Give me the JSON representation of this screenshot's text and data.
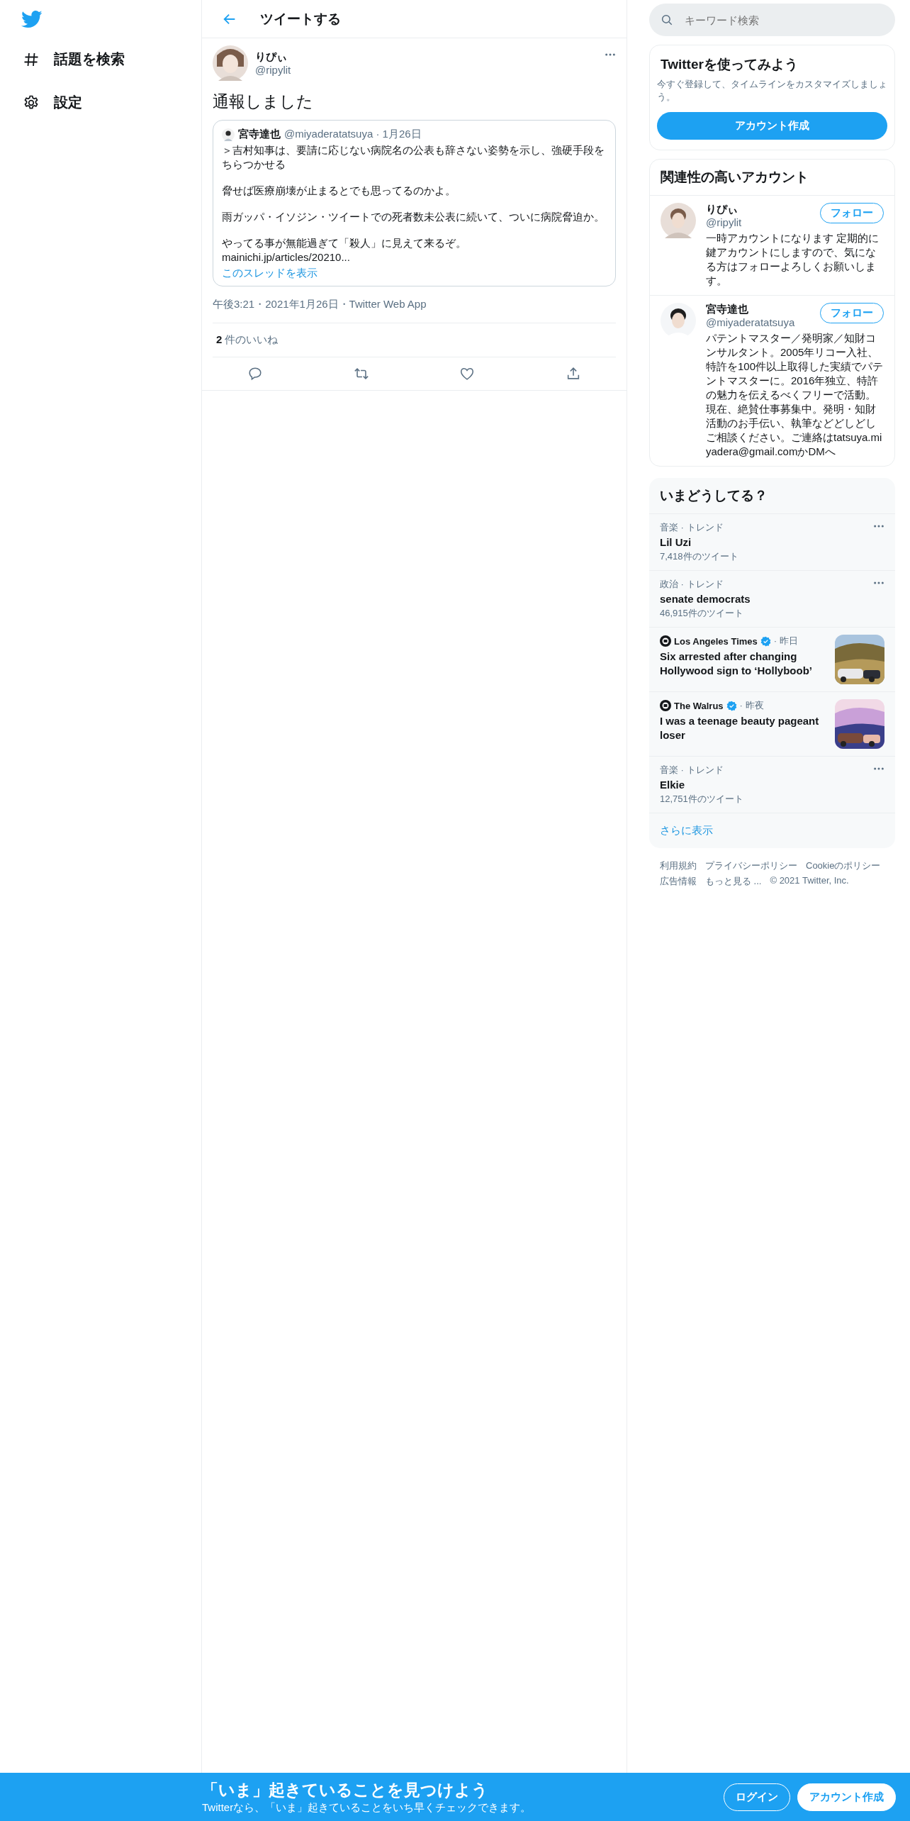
{
  "sidebar": {
    "items": [
      {
        "kind": "explore",
        "label": "話題を検索"
      },
      {
        "kind": "settings",
        "label": "設定"
      }
    ]
  },
  "header": {
    "title": "ツイートする"
  },
  "tweet": {
    "name": "りぴぃ",
    "handle": "@ripylit",
    "text": "通報しました",
    "quote": {
      "name": "宮寺達也",
      "meta": "@miyaderatatsuya · 1月26日",
      "paragraphs": [
        "＞吉村知事は、要請に応じない病院名の公表も辞さない姿勢を示し、強硬手段をちらつかせる",
        "脅せば医療崩壊が止まるとでも思ってるのかよ。",
        "雨ガッパ・イソジン・ツイートでの死者数未公表に続いて、ついに病院脅迫か。",
        "やってる事が無能過ぎて「殺人」に見えて来るぞ。\nmainichi.jp/articles/20210..."
      ],
      "thread_link": "このスレッドを表示"
    },
    "timestamp": "午後3:21・2021年1月26日・Twitter Web App",
    "likes": {
      "count": "2",
      "label": "件のいいね"
    },
    "actions": [
      {
        "kind": "reply"
      },
      {
        "kind": "retweet"
      },
      {
        "kind": "like"
      },
      {
        "kind": "share"
      }
    ]
  },
  "search": {
    "placeholder": "キーワード検索"
  },
  "signup": {
    "title": "Twitterを使ってみよう",
    "text": "今すぐ登録して、タイムラインをカスタマイズしましょう。",
    "button": "アカウント作成"
  },
  "related": {
    "title": "関連性の高いアカウント",
    "accounts": [
      {
        "name": "りぴぃ",
        "handle": "@ripylit",
        "follow": "フォロー",
        "bio": "一時アカウントになります 定期的に鍵アカウントにしますので、気になる方はフォローよろしくお願いします。"
      },
      {
        "name": "宮寺達也",
        "handle": "@miyaderatatsuya",
        "follow": "フォロー",
        "bio": "パテントマスター／発明家／知財コンサルタント。2005年リコー入社、特許を100件以上取得した実績でパテントマスターに。2016年独立、特許の魅力を伝えるべくフリーで活動。現在、絶賛仕事募集中。発明・知財活動のお手伝い、執筆などどしどしご相談ください。ご連絡はtatsuya.miyadera@gmail.comかDMへ"
      }
    ]
  },
  "trends": {
    "title": "いまどうしてる？",
    "items": [
      {
        "kind": "trend",
        "category": "音楽 · トレンド",
        "name": "Lil Uzi",
        "count": "7,418件のツイート"
      },
      {
        "kind": "trend",
        "category": "政治 · トレンド",
        "name": "senate democrats",
        "count": "46,915件のツイート"
      },
      {
        "kind": "news",
        "source": "Los Angeles Times",
        "verified": true,
        "time": "· 昨日",
        "headline": "Six arrested after changing Hollywood sign to ‘Hollyboob’"
      },
      {
        "kind": "news",
        "source": "The Walrus",
        "verified": true,
        "time": "· 昨夜",
        "headline": "I was a teenage beauty pageant loser"
      },
      {
        "kind": "trend",
        "category": "音楽 · トレンド",
        "name": "Elkie",
        "count": "12,751件のツイート"
      }
    ],
    "more": "さらに表示"
  },
  "footer": {
    "links": [
      "利用規約",
      "プライバシーポリシー",
      "Cookieのポリシー",
      "広告情報",
      "もっと見る ...",
      "© 2021 Twitter, Inc."
    ]
  },
  "banner": {
    "title": "「いま」起きていることを見つけよう",
    "subtitle": "Twitterなら、「いま」起きていることをいち早くチェックできます。",
    "buttons": [
      {
        "kind": "outline",
        "label": "ログイン"
      },
      {
        "kind": "filled",
        "label": "アカウント作成"
      }
    ]
  }
}
